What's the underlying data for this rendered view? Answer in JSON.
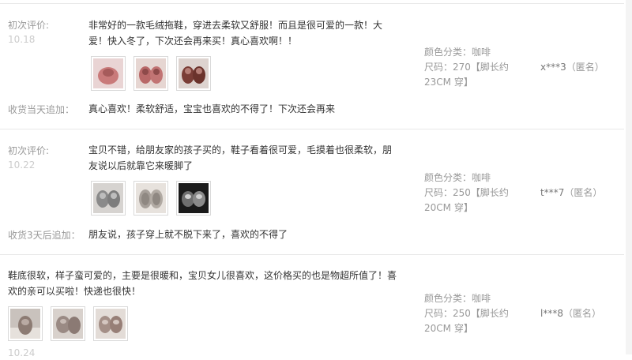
{
  "reviews": [
    {
      "first_label": "初次评价:",
      "first_date": "10.18",
      "content": "非常好的一款毛绒拖鞋，穿进去柔软又舒服！而且是很可爱的一款！大爱！快入冬了，下次还会再来买！真心喜欢啊！！",
      "thumbs": [
        {
          "icon": "pink-slipper-photo",
          "color": "#c97a7a"
        },
        {
          "icon": "pink-slippers-pair-photo",
          "color": "#b96868"
        },
        {
          "icon": "brown-slippers-photo",
          "color": "#7a3d36"
        }
      ],
      "followup_label": "收货当天追加：",
      "followup": "真心喜欢！柔软舒适，宝宝也喜欢的不得了！下次还会再来",
      "color_line": "颜色分类：咖啡",
      "size_line": "尺码：270【脚长约23CM 穿】",
      "user": "x***3",
      "anon": "（匿名）"
    },
    {
      "first_label": "初次评价:",
      "first_date": "10.22",
      "content": "宝贝不错，给朋友家的孩子买的，鞋子看着很可爱，毛摸着也很柔软，朋友说以后就靠它来暖脚了",
      "thumbs": [
        {
          "icon": "grey-slippers-photo",
          "color": "#8a8a8a"
        },
        {
          "icon": "grey-slipper-soles-photo",
          "color": "#a7a09a"
        },
        {
          "icon": "dark-slippers-photo",
          "color": "#3a3a3a"
        }
      ],
      "followup_label": "收货3天后追加：",
      "followup": "朋友说，孩子穿上就不脱下来了，喜欢的不得了",
      "color_line": "颜色分类：咖啡",
      "size_line": "尺码：250【脚长约20CM 穿】",
      "user": "t***7",
      "anon": "（匿名）"
    },
    {
      "content": "鞋底很软，样子蛮可爱的，主要是很暖和，宝贝女儿很喜欢，这价格买的也是物超所值了！喜欢的亲可以买啦！快递也很快！",
      "thumbs": [
        {
          "icon": "slipper-on-floor-photo",
          "color": "#8c7b73"
        },
        {
          "icon": "slippers-closeup-photo",
          "color": "#9a8a84"
        },
        {
          "icon": "slippers-pair-photo",
          "color": "#a48f87"
        }
      ],
      "date": "10.24",
      "color_line": "颜色分类：咖啡",
      "size_line": "尺码：250【脚长约20CM 穿】",
      "user": "l***8",
      "anon": "（匿名）"
    }
  ]
}
